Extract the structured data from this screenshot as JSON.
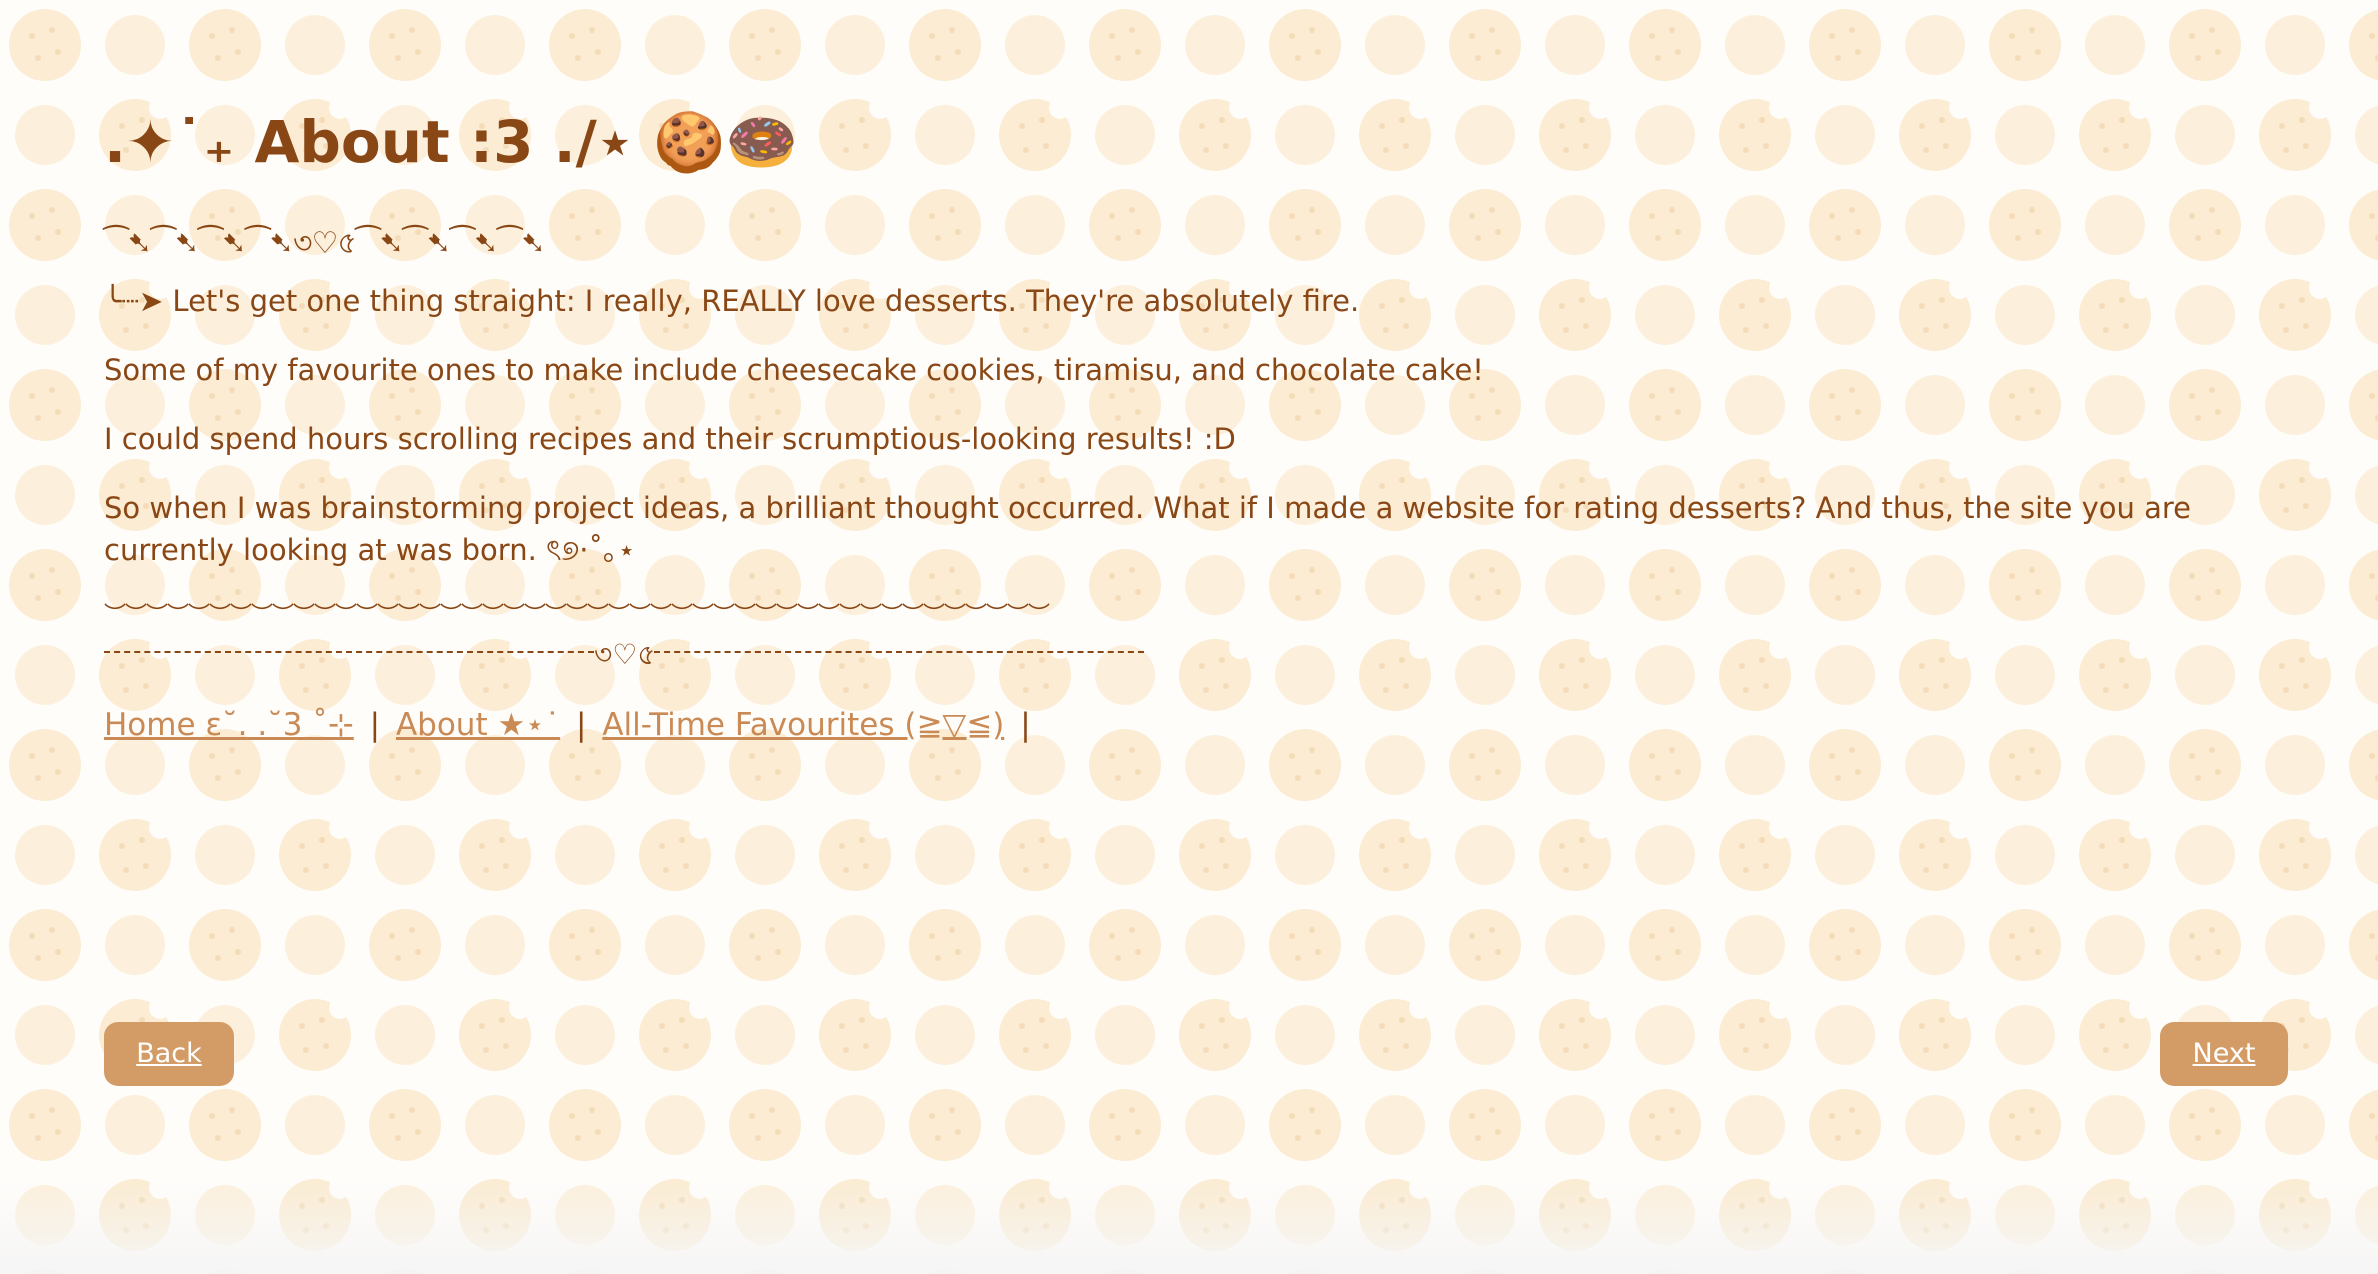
{
  "page": {
    "title": ".✦˙₊ About :3 ./⋆ 🍪🍩",
    "divider_top": "⁀➷⁀➷⁀➷⁀➷৩♡৫⁀➷⁀➷⁀➷⁀➷",
    "paragraphs": [
      "╰┈➤ Let's get one thing straight: I really, REALLY love desserts. They're absolutely fire.",
      "Some of my favourite ones to make include cheesecake cookies, tiramisu, and chocolate cake!",
      "I could spend hours scrolling recipes and their scrumptious-looking results! :D",
      "So when I was brainstorming project ideas, a brilliant thought occurred. What if I made a website for rating desserts? And thus, the site you are currently looking at was born. ৎ୭·˚｡⋆"
    ],
    "scallop_divider": "︶︶︶︶︶︶︶︶︶︶︶︶︶︶︶︶︶︶︶︶︶︶︶︶︶︶︶︶︶︶︶︶︶︶︶︶︶︶︶︶︶︶︶︶︶",
    "dotted_divider_heart": "৩♡৫"
  },
  "nav": {
    "home": "Home ɛ˘. .˘3 ˚⊹",
    "about": "About ★⋆˙",
    "favourites": "All-Time Favourites (≧▽≦)",
    "separator": "|"
  },
  "buttons": {
    "back": "Back",
    "next": "Next"
  },
  "colors": {
    "text": "#8a4716",
    "link": "#c98a55",
    "button_bg": "#d39c66",
    "cookie": "#fbecd3"
  }
}
